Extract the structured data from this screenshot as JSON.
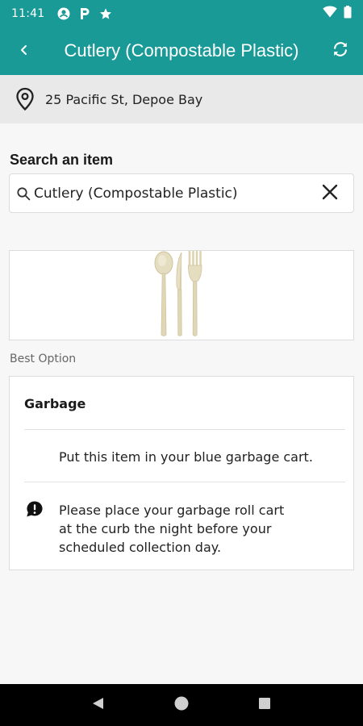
{
  "status_bar": {
    "time": "11:41",
    "icons": [
      "account-circle-icon",
      "parking-p-icon",
      "star-icon",
      "wifi-icon",
      "battery-icon"
    ]
  },
  "app_bar": {
    "title": "Cutlery (Compostable Plastic)",
    "back_icon": "chevron-left-icon",
    "refresh_icon": "refresh-icon"
  },
  "address": {
    "text": "25 Pacific St, Depoe Bay",
    "icon": "location-pin-icon"
  },
  "search": {
    "label": "Search an item",
    "value": "Cutlery (Compostable Plastic)",
    "search_icon": "search-icon",
    "clear_icon": "close-icon"
  },
  "item_image": {
    "icon": "cutlery-image"
  },
  "best_option": {
    "label": "Best Option",
    "title": "Garbage",
    "instruction": "Put this item in your blue garbage cart.",
    "note": "Please place your garbage roll cart at the curb the night before your scheduled collection day.",
    "note_icon": "alert-bubble-icon"
  },
  "colors": {
    "primary": "#1a9a96",
    "address_bg": "#e9e9e9",
    "page_bg": "#f7f7f7"
  }
}
